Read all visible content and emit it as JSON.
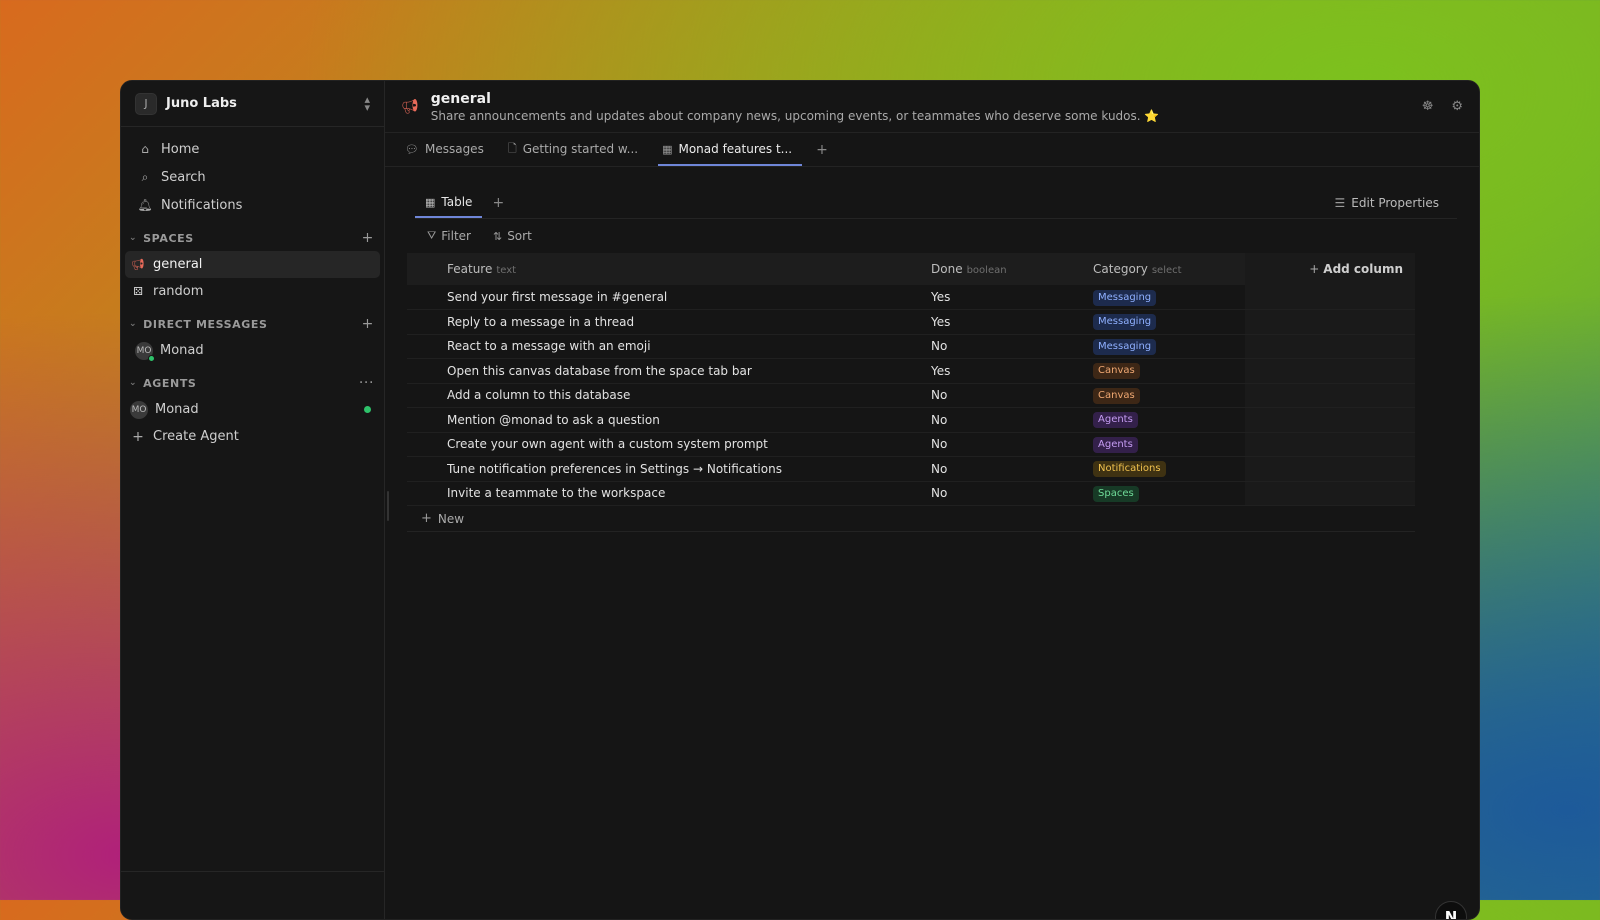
{
  "workspace": {
    "initial": "J",
    "name": "Juno Labs"
  },
  "nav": [
    {
      "label": "Home",
      "icon": "home-icon"
    },
    {
      "label": "Search",
      "icon": "search-icon"
    },
    {
      "label": "Notifications",
      "icon": "bell-icon"
    }
  ],
  "sections": {
    "spaces": {
      "label": "SPACES",
      "items": [
        {
          "label": "general",
          "icon": "megaphone-icon"
        },
        {
          "label": "random",
          "icon": "dice-icon"
        }
      ]
    },
    "dms": {
      "label": "DIRECT MESSAGES",
      "items": [
        {
          "label": "Monad",
          "initials": "MO"
        }
      ]
    },
    "agents": {
      "label": "AGENTS",
      "items": [
        {
          "label": "Monad",
          "initials": "MO"
        }
      ],
      "create_label": "Create Agent"
    }
  },
  "channel": {
    "title": "general",
    "description": "Share announcements and updates about company news, upcoming events, or teammates who deserve some kudos. ⭐"
  },
  "tabs": [
    {
      "label": "Messages",
      "icon": "chat-icon"
    },
    {
      "label": "Getting started w...",
      "icon": "document-icon"
    },
    {
      "label": "Monad features t...",
      "icon": "table-icon"
    }
  ],
  "view": {
    "tab_label": "Table",
    "edit_properties": "Edit Properties",
    "filter": "Filter",
    "sort": "Sort",
    "new_label": "New"
  },
  "table": {
    "columns": [
      {
        "name": "Feature",
        "type": "text"
      },
      {
        "name": "Done",
        "type": "boolean"
      },
      {
        "name": "Category",
        "type": "select"
      }
    ],
    "add_column": "Add column",
    "rows": [
      {
        "feature": "Send your first message in #general",
        "done": "Yes",
        "category": "Messaging"
      },
      {
        "feature": "Reply to a message in a thread",
        "done": "Yes",
        "category": "Messaging"
      },
      {
        "feature": "React to a message with an emoji",
        "done": "No",
        "category": "Messaging"
      },
      {
        "feature": "Open this canvas database from the space tab bar",
        "done": "Yes",
        "category": "Canvas"
      },
      {
        "feature": "Add a column to this database",
        "done": "No",
        "category": "Canvas"
      },
      {
        "feature": "Mention @monad to ask a question",
        "done": "No",
        "category": "Agents"
      },
      {
        "feature": "Create your own agent with a custom system prompt",
        "done": "No",
        "category": "Agents"
      },
      {
        "feature": "Tune notification preferences in Settings → Notifications",
        "done": "No",
        "category": "Notifications"
      },
      {
        "feature": "Invite a teammate to the workspace",
        "done": "No",
        "category": "Spaces"
      }
    ]
  },
  "category_colors": {
    "Messaging": {
      "bg": "#1d2b4d",
      "fg": "#8fb0ff"
    },
    "Canvas": {
      "bg": "#3d2716",
      "fg": "#f0a872"
    },
    "Agents": {
      "bg": "#33204a",
      "fg": "#c59cf2"
    },
    "Notifications": {
      "bg": "#3f3212",
      "fg": "#f1c24e"
    },
    "Spaces": {
      "bg": "#173a26",
      "fg": "#6fdb98"
    }
  },
  "fab_label": "N"
}
